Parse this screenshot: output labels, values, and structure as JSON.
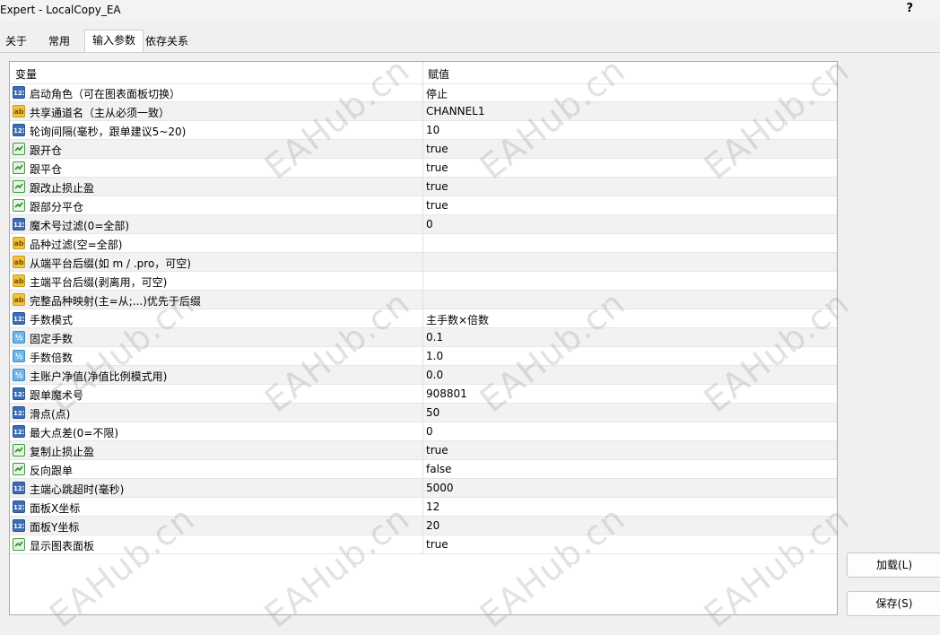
{
  "window": {
    "title": "Expert - LocalCopy_EA",
    "help_label": "?"
  },
  "tabs": [
    {
      "label": "关于"
    },
    {
      "label": "常用"
    },
    {
      "label": "输入参数"
    },
    {
      "label": "依存关系"
    }
  ],
  "active_tab": "输入参数",
  "grid": {
    "headers": {
      "variable": "变量",
      "value": "赋值"
    },
    "rows": [
      {
        "type": "int",
        "type_icon": "int-type-icon",
        "name": "启动角色（可在图表面板切换）",
        "value": "停止"
      },
      {
        "type": "str",
        "type_icon": "string-type-icon",
        "name": "共享通道名（主从必须一致）",
        "value": "CHANNEL1"
      },
      {
        "type": "int",
        "type_icon": "int-type-icon",
        "name": "轮询间隔(毫秒，跟单建议5~20)",
        "value": "10"
      },
      {
        "type": "bool",
        "type_icon": "bool-type-icon",
        "name": "跟开仓",
        "value": "true"
      },
      {
        "type": "bool",
        "type_icon": "bool-type-icon",
        "name": "跟平仓",
        "value": "true"
      },
      {
        "type": "bool",
        "type_icon": "bool-type-icon",
        "name": "跟改止损止盈",
        "value": "true"
      },
      {
        "type": "bool",
        "type_icon": "bool-type-icon",
        "name": "跟部分平仓",
        "value": "true"
      },
      {
        "type": "int",
        "type_icon": "int-type-icon",
        "name": "魔术号过滤(0=全部)",
        "value": "0"
      },
      {
        "type": "str",
        "type_icon": "string-type-icon",
        "name": "品种过滤(空=全部)",
        "value": ""
      },
      {
        "type": "str",
        "type_icon": "string-type-icon",
        "name": "从端平台后缀(如 m / .pro，可空)",
        "value": ""
      },
      {
        "type": "str",
        "type_icon": "string-type-icon",
        "name": "主端平台后缀(剥离用，可空)",
        "value": ""
      },
      {
        "type": "str",
        "type_icon": "string-type-icon",
        "name": "完整品种映射(主=从;...)优先于后缀",
        "value": ""
      },
      {
        "type": "int",
        "type_icon": "int-type-icon",
        "name": "手数模式",
        "value": "主手数×倍数"
      },
      {
        "type": "dbl",
        "type_icon": "double-type-icon",
        "name": "固定手数",
        "value": "0.1"
      },
      {
        "type": "dbl",
        "type_icon": "double-type-icon",
        "name": "手数倍数",
        "value": "1.0"
      },
      {
        "type": "dbl",
        "type_icon": "double-type-icon",
        "name": "主账户净值(净值比例模式用)",
        "value": "0.0"
      },
      {
        "type": "int",
        "type_icon": "int-type-icon",
        "name": "跟单魔术号",
        "value": "908801"
      },
      {
        "type": "int",
        "type_icon": "int-type-icon",
        "name": "滑点(点)",
        "value": "50"
      },
      {
        "type": "int",
        "type_icon": "int-type-icon",
        "name": "最大点差(0=不限)",
        "value": "0"
      },
      {
        "type": "bool",
        "type_icon": "bool-type-icon",
        "name": "复制止损止盈",
        "value": "true"
      },
      {
        "type": "bool",
        "type_icon": "bool-type-icon",
        "name": "反向跟单",
        "value": "false"
      },
      {
        "type": "int",
        "type_icon": "int-type-icon",
        "name": "主端心跳超时(毫秒)",
        "value": "5000"
      },
      {
        "type": "int",
        "type_icon": "int-type-icon",
        "name": "面板X坐标",
        "value": "12"
      },
      {
        "type": "int",
        "type_icon": "int-type-icon",
        "name": "面板Y坐标",
        "value": "20"
      },
      {
        "type": "bool",
        "type_icon": "bool-type-icon",
        "name": "显示图表面板",
        "value": "true"
      }
    ]
  },
  "type_icon_text": {
    "int": "123",
    "str": "ab",
    "dbl": "½"
  },
  "buttons": {
    "load": "加载(L)",
    "save": "保存(S)"
  },
  "watermark": {
    "text": "EAHub.cn"
  },
  "colors": {
    "row_alt": "#f2f2f2",
    "int_icon": "#3d6fb6",
    "string_icon": "#f0c440",
    "double_icon": "#6fb7e8",
    "bool_icon": "#3f9b3f"
  }
}
